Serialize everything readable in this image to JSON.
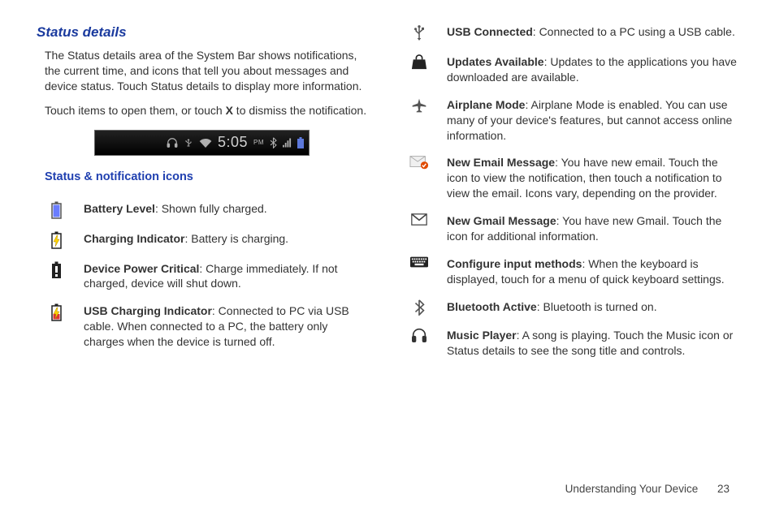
{
  "section_title": "Status details",
  "intro_1": "The Status details area of the System Bar shows notifications, the current time, and icons that tell you about messages and device status. Touch Status details to display more information.",
  "intro_2_pre": "Touch items to open them, or touch ",
  "intro_2_bold": "X",
  "intro_2_post": " to dismiss the notification.",
  "status_bar_time": "5:05",
  "status_bar_ampm": "PM",
  "sub_heading": "Status & notification icons",
  "left_items": [
    {
      "name": "battery-level",
      "title": "Battery Level",
      "desc": ": Shown fully charged."
    },
    {
      "name": "charging-indicator",
      "title": "Charging Indicator",
      "desc": ": Battery is charging."
    },
    {
      "name": "device-power-critical",
      "title": "Device Power Critical",
      "desc": ": Charge immediately. If not charged, device will shut down."
    },
    {
      "name": "usb-charging-indicator",
      "title": "USB Charging Indicator",
      "desc": ": Connected to PC via USB cable. When connected to a PC, the battery only charges when the device is turned off."
    }
  ],
  "right_items": [
    {
      "name": "usb-connected",
      "title": "USB Connected",
      "desc": ": Connected to a PC using a USB cable."
    },
    {
      "name": "updates-available",
      "title": "Updates Available",
      "desc": ": Updates to the applications you have downloaded are available."
    },
    {
      "name": "airplane-mode",
      "title": "Airplane Mode",
      "desc": ": Airplane Mode is enabled. You can use many of your device's features, but cannot access online information."
    },
    {
      "name": "new-email",
      "title": "New Email Message",
      "desc": ": You have new email. Touch the icon to view the notification, then touch a notification to view the email. Icons vary, depending on the provider."
    },
    {
      "name": "new-gmail",
      "title": "New Gmail Message",
      "desc": ": You have new Gmail. Touch the icon for additional information."
    },
    {
      "name": "configure-input",
      "title": "Configure input methods",
      "desc": ": When the keyboard is displayed, touch for a menu of quick keyboard settings."
    },
    {
      "name": "bluetooth-active",
      "title": "Bluetooth Active",
      "desc": ": Bluetooth is turned on."
    },
    {
      "name": "music-player",
      "title": "Music Player",
      "desc": ": A song is playing. Touch the Music icon or Status details to see the song title and controls."
    }
  ],
  "footer_text": "Understanding Your Device",
  "page_number": "23"
}
